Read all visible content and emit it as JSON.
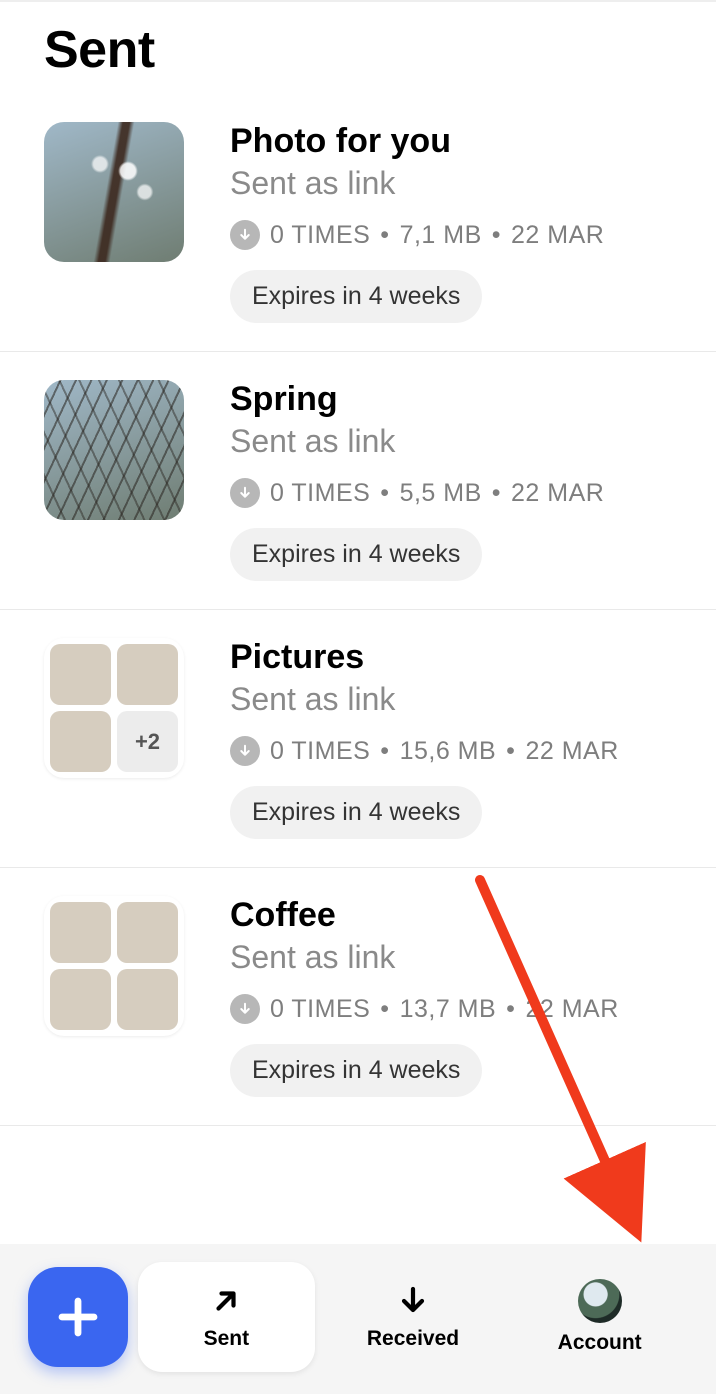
{
  "header": {
    "title": "Sent"
  },
  "items": [
    {
      "title": "Photo for you",
      "subtitle": "Sent as link",
      "downloads": "0 TIMES",
      "size": "7,1 MB",
      "date": "22 MAR",
      "expiry": "Expires in 4 weeks",
      "thumb_kind": "single",
      "thumb_class": "ph-blossom"
    },
    {
      "title": "Spring",
      "subtitle": "Sent as link",
      "downloads": "0 TIMES",
      "size": "5,5 MB",
      "date": "22 MAR",
      "expiry": "Expires in 4 weeks",
      "thumb_kind": "single",
      "thumb_class": "ph-branches"
    },
    {
      "title": "Pictures",
      "subtitle": "Sent as link",
      "downloads": "0 TIMES",
      "size": "15,6 MB",
      "date": "22 MAR",
      "expiry": "Expires in 4 weeks",
      "thumb_kind": "grid",
      "grid_cells": [
        "ph-food1",
        "ph-food2",
        "ph-food3",
        "more"
      ],
      "more_label": "+2"
    },
    {
      "title": "Coffee",
      "subtitle": "Sent as link",
      "downloads": "0 TIMES",
      "size": "13,7 MB",
      "date": "22 MAR",
      "expiry": "Expires in 4 weeks",
      "thumb_kind": "grid",
      "grid_cells": [
        "ph-coffee1",
        "ph-coffee2",
        "ph-coffee3",
        "ph-coffee4"
      ]
    }
  ],
  "stats_separator": " • ",
  "nav": {
    "sent": "Sent",
    "received": "Received",
    "account": "Account"
  },
  "annotation": {
    "arrow_color": "#f03a1c"
  }
}
